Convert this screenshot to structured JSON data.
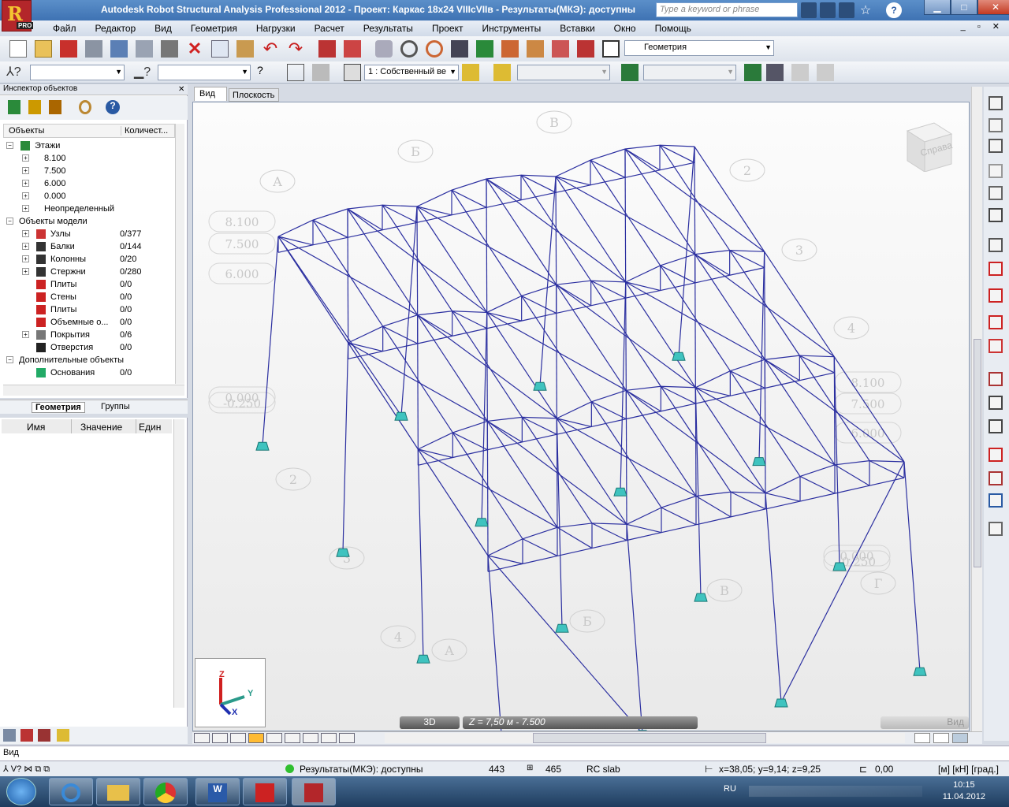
{
  "window": {
    "title": "Autodesk Robot Structural Analysis Professional 2012 - Проект: Каркас 18x24 VIIIcVIIв - Результаты(МКЭ): доступны",
    "logo_badge": "PRO",
    "search_placeholder": "Type a keyword or phrase"
  },
  "menu": [
    "Файл",
    "Редактор",
    "Вид",
    "Геометрия",
    "Нагрузки",
    "Расчет",
    "Результаты",
    "Проект",
    "Инструменты",
    "Вставки",
    "Окно",
    "Помощь"
  ],
  "toolbar": {
    "layout_combo": "Геометрия",
    "load_case_combo": "1 : Собственный ве"
  },
  "inspector": {
    "title": "Инспектор объектов",
    "col_objects": "Объекты",
    "col_count": "Количест...",
    "tree": [
      {
        "label": "Этажи",
        "count": "",
        "level": 0,
        "exp": "−"
      },
      {
        "label": "8.100",
        "count": "",
        "level": 1,
        "exp": "+"
      },
      {
        "label": "7.500",
        "count": "",
        "level": 1,
        "exp": "+"
      },
      {
        "label": "6.000",
        "count": "",
        "level": 1,
        "exp": "+"
      },
      {
        "label": "0.000",
        "count": "",
        "level": 1,
        "exp": "+"
      },
      {
        "label": "Неопределенный",
        "count": "",
        "level": 1,
        "exp": "+"
      },
      {
        "label": "Объекты модели",
        "count": "",
        "level": 0,
        "exp": "−"
      },
      {
        "label": "Узлы",
        "count": "0/377",
        "level": 1,
        "exp": "+"
      },
      {
        "label": "Балки",
        "count": "0/144",
        "level": 1,
        "exp": "+"
      },
      {
        "label": "Колонны",
        "count": "0/20",
        "level": 1,
        "exp": "+"
      },
      {
        "label": "Стержни",
        "count": "0/280",
        "level": 1,
        "exp": "+"
      },
      {
        "label": "Плиты",
        "count": "0/0",
        "level": 1,
        "exp": ""
      },
      {
        "label": "Стены",
        "count": "0/0",
        "level": 1,
        "exp": ""
      },
      {
        "label": "Плиты",
        "count": "0/0",
        "level": 1,
        "exp": ""
      },
      {
        "label": "Объемные о...",
        "count": "0/0",
        "level": 1,
        "exp": ""
      },
      {
        "label": "Покрытия",
        "count": "0/6",
        "level": 1,
        "exp": "+"
      },
      {
        "label": "Отверстия",
        "count": "0/0",
        "level": 1,
        "exp": ""
      },
      {
        "label": "Дополнительные объекты",
        "count": "",
        "level": 0,
        "exp": "−"
      },
      {
        "label": "Основания",
        "count": "0/0",
        "level": 1,
        "exp": ""
      }
    ],
    "tabs": [
      "Геометрия",
      "Группы"
    ]
  },
  "props": {
    "col_name": "Имя",
    "col_value": "Значение",
    "col_unit": "Един"
  },
  "viewport": {
    "tab_view": "Вид",
    "tab_plane": "Плоскость",
    "viewcube_label": "Справа",
    "mode_3d": "3D",
    "z_level": "Z = 7,50 м - 7.500",
    "corner_label": "Вид",
    "axis_labels": {
      "z": "Z",
      "y": "Y",
      "x": "X"
    },
    "grid_labels": [
      "В",
      "Б",
      "А",
      "2",
      "3",
      "4",
      "2",
      "3",
      "4",
      "А",
      "Б",
      "В",
      "Г"
    ],
    "level_labels": [
      "8.100",
      "7.500",
      "6.000",
      "0.000",
      "-0.250",
      "8.100",
      "7.500",
      "6.000",
      "0.000",
      "-0.250"
    ]
  },
  "cmdline": "Вид",
  "status": {
    "results": "Результаты(МКЭ): доступны",
    "nodes": "443",
    "bars": "465",
    "section": "RC slab",
    "coords": "x=38,05; y=9,14; z=9,25",
    "angle": "0,00",
    "units": "[м] [кН] [град.]"
  },
  "taskbar": {
    "lang": "RU",
    "time": "10:15",
    "date": "11.04.2012"
  },
  "colors": {
    "frame": "#2b2fa0",
    "support": "#3fc3bf",
    "title_bar": "#3e72b3"
  }
}
